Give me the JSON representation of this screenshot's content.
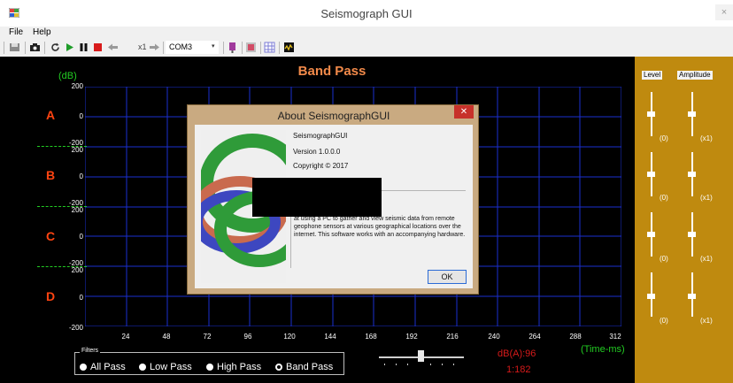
{
  "window": {
    "title": "Seismograph GUI",
    "close_glyph": "×"
  },
  "menu": [
    {
      "label": "File"
    },
    {
      "label": "Help"
    }
  ],
  "toolbar": {
    "icons": [
      "disk-icon",
      "camera-icon",
      "refresh-icon",
      "play-icon",
      "pause-icon",
      "stop-icon",
      "left-arrow-icon",
      "right-arrow-icon",
      "marker-icon",
      "record-icon",
      "grid-icon",
      "meter-icon"
    ],
    "zoom_label": "x1",
    "port": "COM3",
    "port_arrow": "▾"
  },
  "scope": {
    "title": "Band Pass",
    "ylabel": "(dB)",
    "xlabel": "(Time-ms)",
    "channels": [
      "A",
      "B",
      "C",
      "D"
    ],
    "y_ticks": [
      "200",
      "0",
      "-200",
      "200",
      "0",
      "-200",
      "200",
      "0",
      "-200",
      "200",
      "0",
      "-200"
    ],
    "x_ticks": [
      "24",
      "48",
      "72",
      "96",
      "120",
      "144",
      "168",
      "192",
      "216",
      "240",
      "264",
      "288",
      "312"
    ],
    "colors": {
      "background": "#000000",
      "grid": "#1a2fd1",
      "axis_text": "#ffffff",
      "title": "#f28a4a",
      "labels": "#22cc22",
      "channel": "#ff4411"
    }
  },
  "filters": {
    "legend": "Filters",
    "options": [
      {
        "label": "All Pass",
        "selected": false
      },
      {
        "label": "Low Pass",
        "selected": false
      },
      {
        "label": "High Pass",
        "selected": false
      },
      {
        "label": "Band Pass",
        "selected": true
      }
    ]
  },
  "speed_slider": {
    "value_fraction": 0.47
  },
  "readout": {
    "dba": "dB(A):96",
    "ratio": "1:182"
  },
  "right_panel": {
    "level_label": "Level",
    "amplitude_label": "Amplitude",
    "level_values": [
      "(0)",
      "(0)",
      "(0)",
      "(0)"
    ],
    "amplitude_values": [
      "(x1)",
      "(x1)",
      "(x1)",
      "(x1)"
    ],
    "color": "#bf8a0f"
  },
  "about": {
    "title": "About SeismographGUI",
    "close_glyph": "✕",
    "product": "SeismographGUI",
    "version": "Version 1.0.0.0",
    "copyright": "Copyright © 2017",
    "description": "at using a PC to gather and view seismic data from remote geophone sensors at various geographical locations over the internet. This software works with an accompanying hardware.",
    "ok_label": "OK"
  }
}
